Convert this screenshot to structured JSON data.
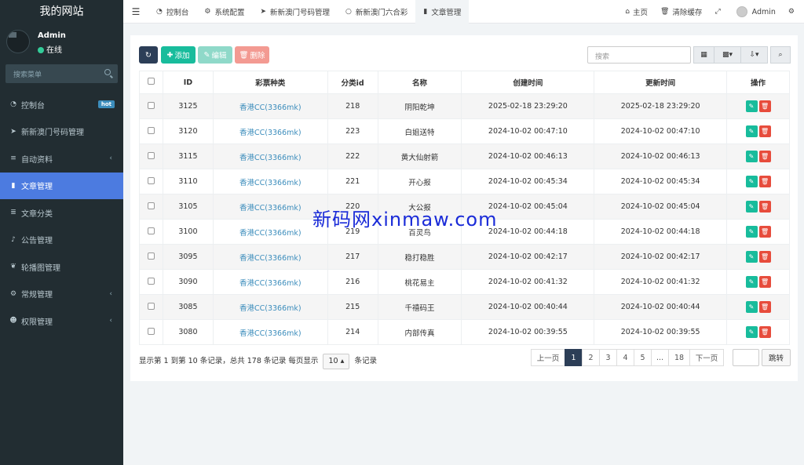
{
  "sidebar": {
    "brand": "我的网站",
    "user": {
      "name": "Admin",
      "status": "在线"
    },
    "search_placeholder": "搜索菜单",
    "items": [
      {
        "label": "控制台",
        "icon": "dashboard-icon",
        "glyph": "◔",
        "badge": "hot"
      },
      {
        "label": "新新澳门号码管理",
        "icon": "send-icon",
        "glyph": "➤"
      },
      {
        "label": "自动资料",
        "icon": "list-icon",
        "glyph": "≡",
        "chevron": "‹"
      },
      {
        "label": "文章管理",
        "icon": "bookmark-icon",
        "glyph": "▮",
        "active": true
      },
      {
        "label": "文章分类",
        "icon": "list-icon",
        "glyph": "≣"
      },
      {
        "label": "公告管理",
        "icon": "bell-icon",
        "glyph": "♪"
      },
      {
        "label": "轮播图管理",
        "icon": "leaf-icon",
        "glyph": "❦"
      },
      {
        "label": "常规管理",
        "icon": "cogs-icon",
        "glyph": "⚙",
        "chevron": "‹"
      },
      {
        "label": "权限管理",
        "icon": "group-icon",
        "glyph": "☻",
        "chevron": "‹"
      }
    ]
  },
  "topbar": {
    "tabs": [
      {
        "label": "控制台",
        "glyph": "◔",
        "icon": "dashboard-icon"
      },
      {
        "label": "系统配置",
        "glyph": "⚙",
        "icon": "gear-icon"
      },
      {
        "label": "新新澳门号码管理",
        "glyph": "➤",
        "icon": "send-icon"
      },
      {
        "label": "新新澳门六合彩",
        "glyph": "○",
        "icon": "circle-icon"
      },
      {
        "label": "文章管理",
        "glyph": "▮",
        "icon": "bookmark-icon",
        "active": true
      }
    ],
    "home": "主页",
    "clear_cache": "清除缓存",
    "user": "Admin"
  },
  "toolbar": {
    "add": "添加",
    "edit": "编辑",
    "delete": "删除",
    "search_placeholder": "搜索"
  },
  "table": {
    "columns": [
      "ID",
      "彩票种类",
      "分类id",
      "名称",
      "创建时间",
      "更新时间",
      "操作"
    ],
    "rows": [
      {
        "id": "3125",
        "type": "香港CC(3366mk)",
        "cat": "218",
        "name": "阴阳乾坤",
        "created": "2025-02-18 23:29:20",
        "updated": "2025-02-18 23:29:20"
      },
      {
        "id": "3120",
        "type": "香港CC(3366mk)",
        "cat": "223",
        "name": "白姐送特",
        "created": "2024-10-02 00:47:10",
        "updated": "2024-10-02 00:47:10"
      },
      {
        "id": "3115",
        "type": "香港CC(3366mk)",
        "cat": "222",
        "name": "黄大仙射箭",
        "created": "2024-10-02 00:46:13",
        "updated": "2024-10-02 00:46:13"
      },
      {
        "id": "3110",
        "type": "香港CC(3366mk)",
        "cat": "221",
        "name": "开心报",
        "created": "2024-10-02 00:45:34",
        "updated": "2024-10-02 00:45:34"
      },
      {
        "id": "3105",
        "type": "香港CC(3366mk)",
        "cat": "220",
        "name": "大公报",
        "created": "2024-10-02 00:45:04",
        "updated": "2024-10-02 00:45:04"
      },
      {
        "id": "3100",
        "type": "香港CC(3366mk)",
        "cat": "219",
        "name": "百灵鸟",
        "created": "2024-10-02 00:44:18",
        "updated": "2024-10-02 00:44:18"
      },
      {
        "id": "3095",
        "type": "香港CC(3366mk)",
        "cat": "217",
        "name": "稳打稳胜",
        "created": "2024-10-02 00:42:17",
        "updated": "2024-10-02 00:42:17"
      },
      {
        "id": "3090",
        "type": "香港CC(3366mk)",
        "cat": "216",
        "name": "桃花易主",
        "created": "2024-10-02 00:41:32",
        "updated": "2024-10-02 00:41:32"
      },
      {
        "id": "3085",
        "type": "香港CC(3366mk)",
        "cat": "215",
        "name": "千禧码王",
        "created": "2024-10-02 00:40:44",
        "updated": "2024-10-02 00:40:44"
      },
      {
        "id": "3080",
        "type": "香港CC(3366mk)",
        "cat": "214",
        "name": "内部传真",
        "created": "2024-10-02 00:39:55",
        "updated": "2024-10-02 00:39:55"
      }
    ]
  },
  "pager": {
    "info_prefix": "显示第 1 到第 10 条记录，总共 178 条记录 每页显示",
    "page_size": "10",
    "info_suffix": "条记录",
    "prev": "上一页",
    "next": "下一页",
    "pages": [
      "1",
      "2",
      "3",
      "4",
      "5",
      "...",
      "18"
    ],
    "jump": "跳转"
  },
  "watermark": "新码网xinmaw.com",
  "colors": {
    "sidebar_bg": "#222d32",
    "active": "#4c7be0",
    "primary": "#2c3e57",
    "success": "#18bc9c",
    "danger": "#e74c3c",
    "link": "#3c8dbc"
  }
}
